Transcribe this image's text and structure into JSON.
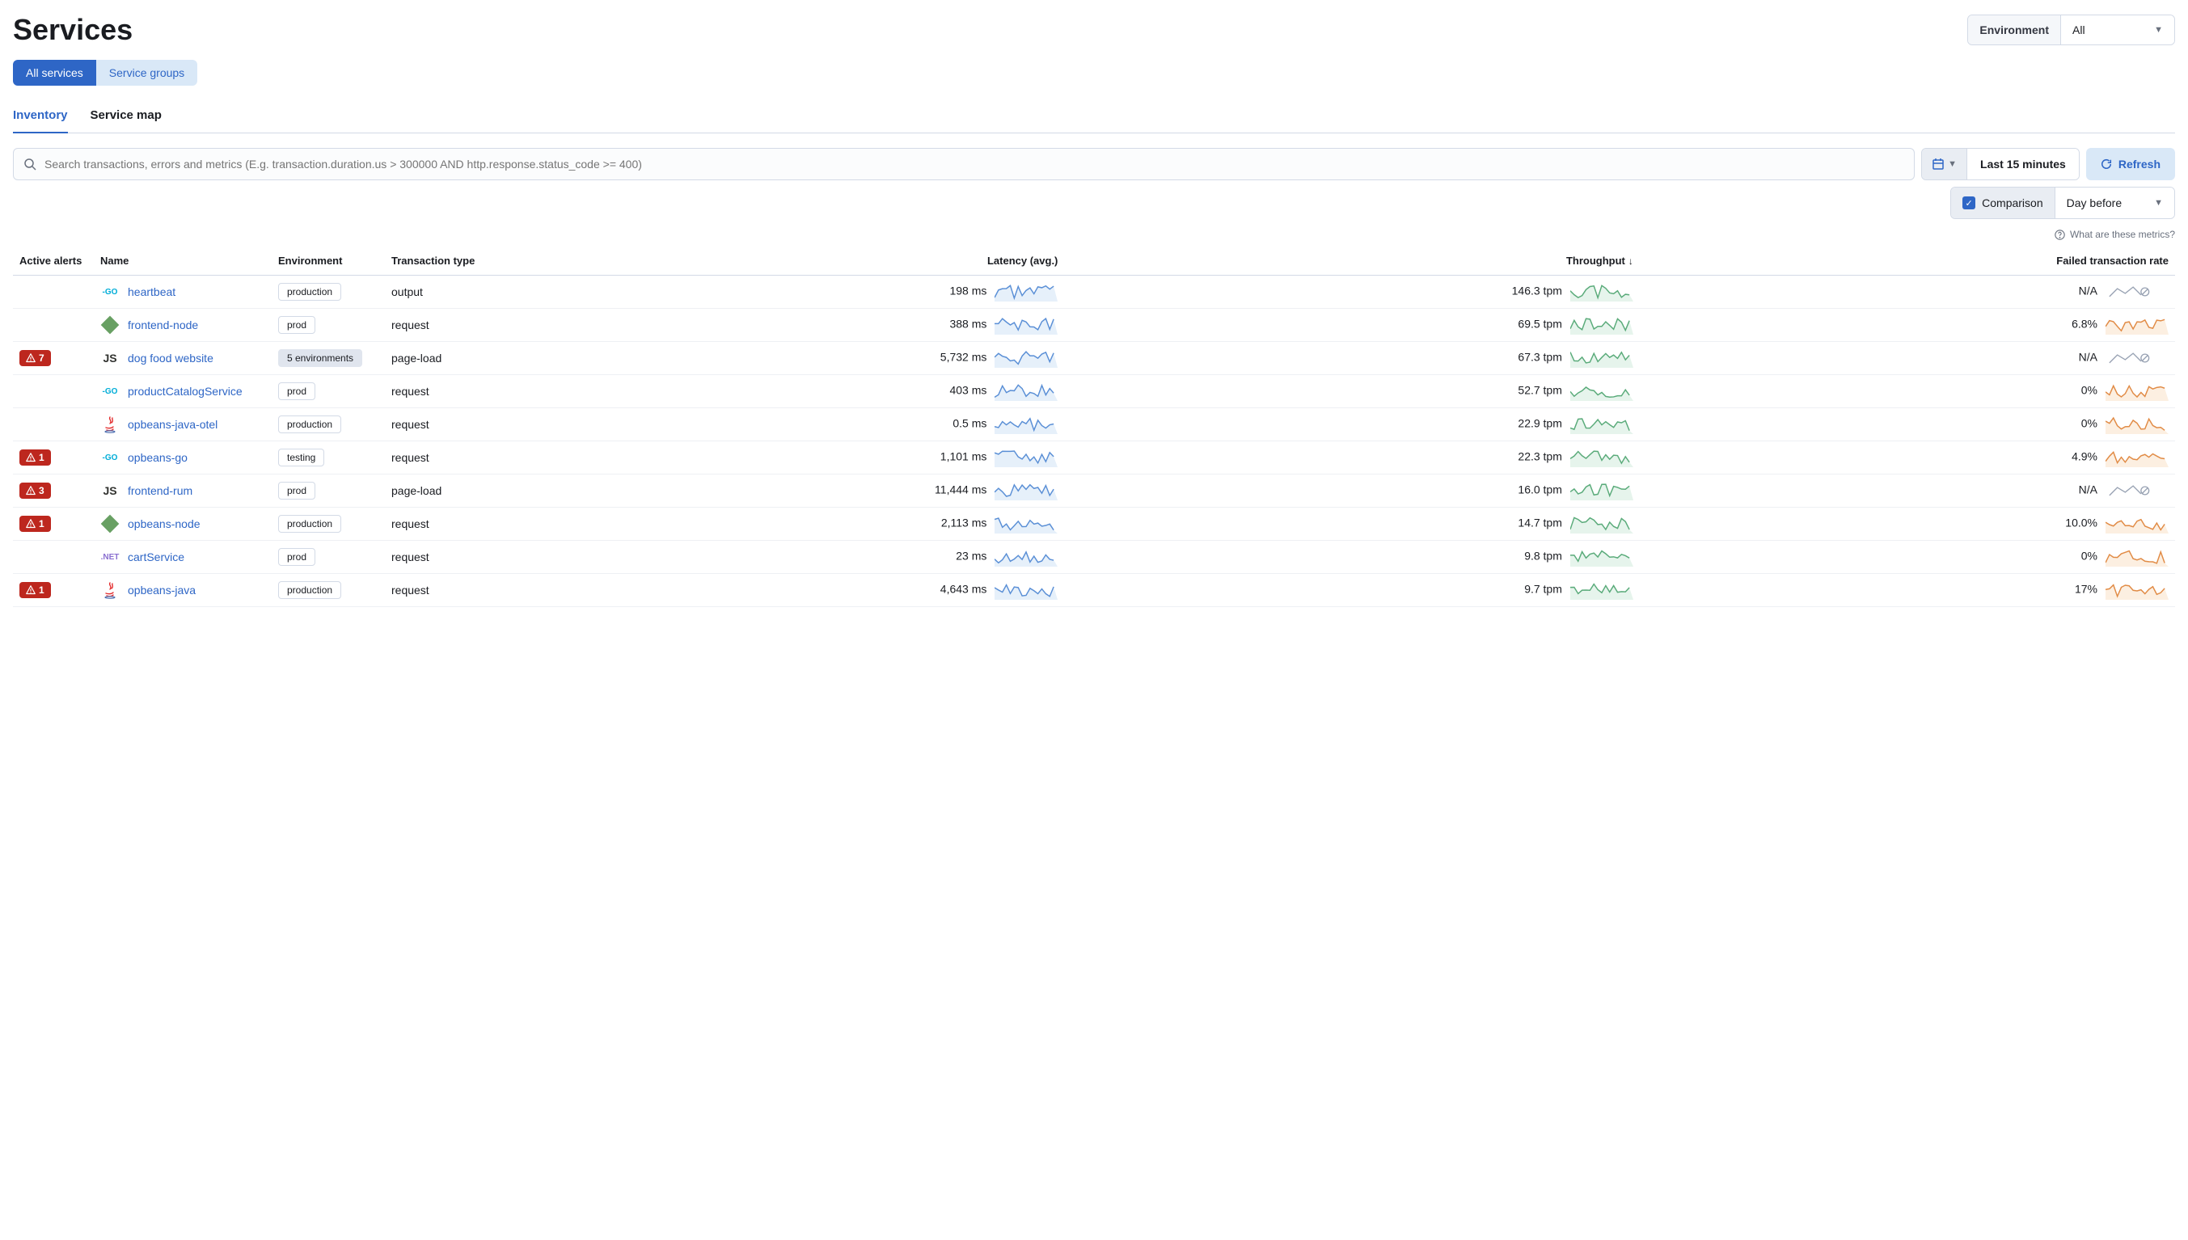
{
  "page_title": "Services",
  "env_selector": {
    "label": "Environment",
    "value": "All"
  },
  "toggle": {
    "active": "All services",
    "inactive": "Service groups"
  },
  "tabs": {
    "active": "Inventory",
    "other": "Service map"
  },
  "search": {
    "placeholder": "Search transactions, errors and metrics (E.g. transaction.duration.us > 300000 AND http.response.status_code >= 400)"
  },
  "time_range": "Last 15 minutes",
  "refresh_label": "Refresh",
  "comparison": {
    "label": "Comparison",
    "value": "Day before"
  },
  "metrics_hint": "What are these metrics?",
  "columns": {
    "alerts": "Active alerts",
    "name": "Name",
    "env": "Environment",
    "txn": "Transaction type",
    "latency": "Latency (avg.)",
    "throughput": "Throughput",
    "failed": "Failed transaction rate"
  },
  "rows": [
    {
      "alert": "",
      "tech": "go",
      "name": "heartbeat",
      "env": "production",
      "env_multi": false,
      "txn": "output",
      "latency": "198 ms",
      "throughput": "146.3 tpm",
      "failed": "N/A",
      "failed_na": true
    },
    {
      "alert": "",
      "tech": "node",
      "name": "frontend-node",
      "env": "prod",
      "env_multi": false,
      "txn": "request",
      "latency": "388 ms",
      "throughput": "69.5 tpm",
      "failed": "6.8%",
      "failed_na": false
    },
    {
      "alert": "7",
      "tech": "js",
      "name": "dog food website",
      "env": "5 environments",
      "env_multi": true,
      "txn": "page-load",
      "latency": "5,732 ms",
      "throughput": "67.3 tpm",
      "failed": "N/A",
      "failed_na": true
    },
    {
      "alert": "",
      "tech": "go",
      "name": "productCatalogService",
      "env": "prod",
      "env_multi": false,
      "txn": "request",
      "latency": "403 ms",
      "throughput": "52.7 tpm",
      "failed": "0%",
      "failed_na": false
    },
    {
      "alert": "",
      "tech": "java",
      "name": "opbeans-java-otel",
      "env": "production",
      "env_multi": false,
      "txn": "request",
      "latency": "0.5 ms",
      "throughput": "22.9 tpm",
      "failed": "0%",
      "failed_na": false
    },
    {
      "alert": "1",
      "tech": "go",
      "name": "opbeans-go",
      "env": "testing",
      "env_multi": false,
      "txn": "request",
      "latency": "1,101 ms",
      "throughput": "22.3 tpm",
      "failed": "4.9%",
      "failed_na": false
    },
    {
      "alert": "3",
      "tech": "js",
      "name": "frontend-rum",
      "env": "prod",
      "env_multi": false,
      "txn": "page-load",
      "latency": "11,444 ms",
      "throughput": "16.0 tpm",
      "failed": "N/A",
      "failed_na": true
    },
    {
      "alert": "1",
      "tech": "node",
      "name": "opbeans-node",
      "env": "production",
      "env_multi": false,
      "txn": "request",
      "latency": "2,113 ms",
      "throughput": "14.7 tpm",
      "failed": "10.0%",
      "failed_na": false
    },
    {
      "alert": "",
      "tech": "dotnet",
      "name": "cartService",
      "env": "prod",
      "env_multi": false,
      "txn": "request",
      "latency": "23 ms",
      "throughput": "9.8 tpm",
      "failed": "0%",
      "failed_na": false
    },
    {
      "alert": "1",
      "tech": "java",
      "name": "opbeans-java",
      "env": "production",
      "env_multi": false,
      "txn": "request",
      "latency": "4,643 ms",
      "throughput": "9.7 tpm",
      "failed": "17%",
      "failed_na": false
    }
  ]
}
